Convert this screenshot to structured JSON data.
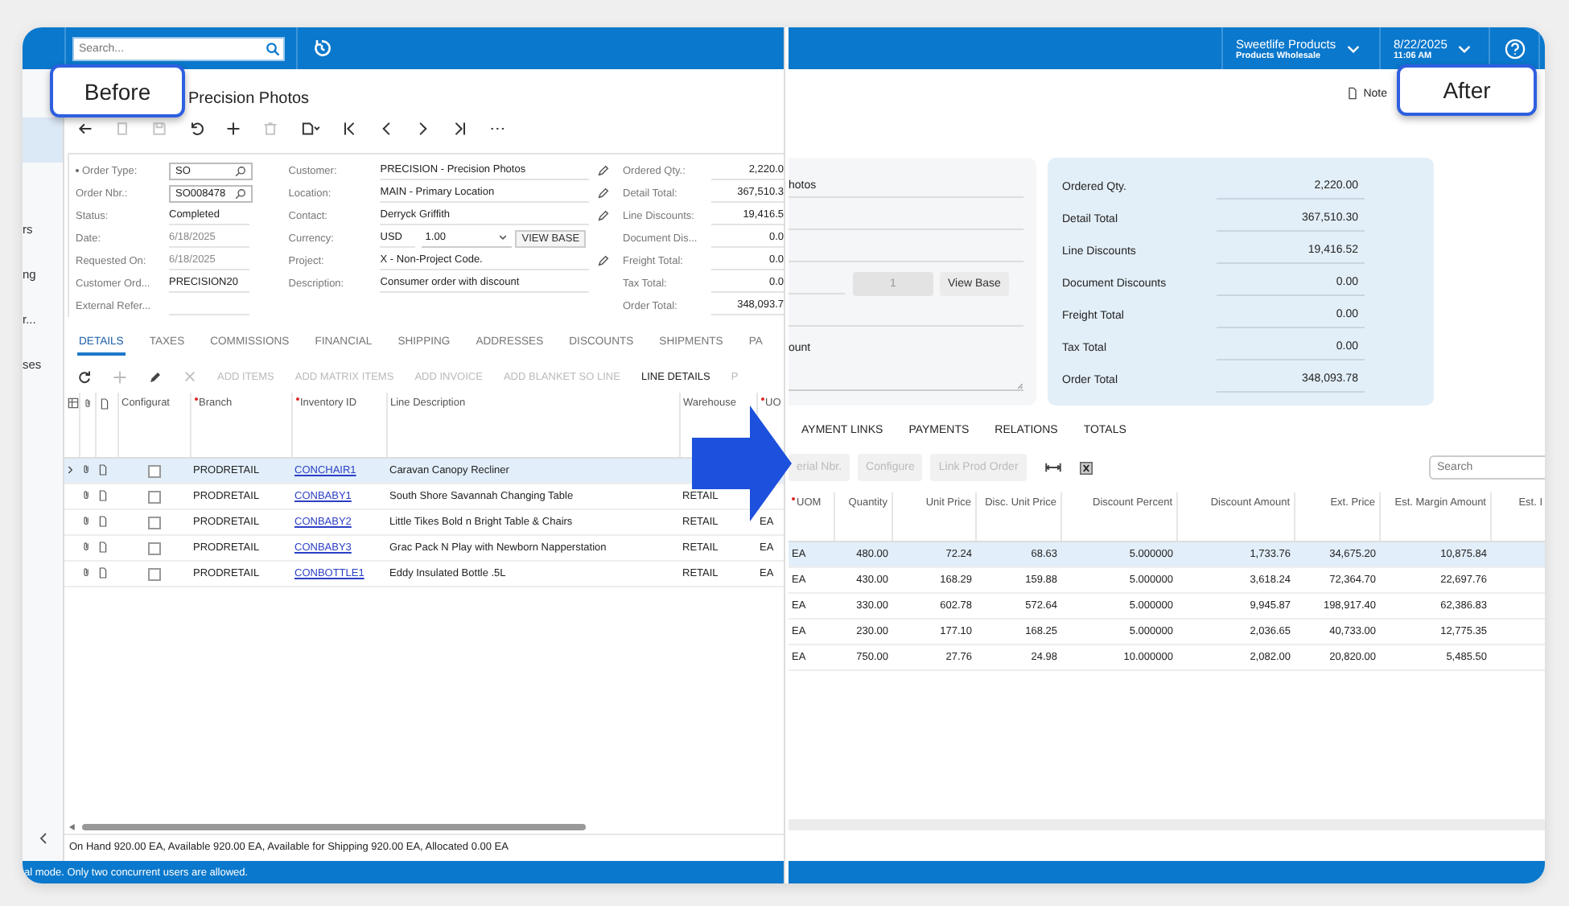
{
  "before": {
    "badge": "Before",
    "search": {
      "placeholder": "Search..."
    },
    "sidebar": {
      "items": [
        {
          "selected": true
        },
        {
          "label": "rs",
          "selected": false
        },
        {
          "label": "ng",
          "selected": false
        },
        {
          "label": "r...",
          "selected": false
        },
        {
          "label": "ses",
          "selected": false
        }
      ]
    },
    "title": "Precision Photos",
    "form": {
      "column_1": [
        {
          "label": "Order Type:",
          "required": true,
          "kind": "lookup",
          "value": "SO",
          "disabled": false
        },
        {
          "label": "Order Nbr.:",
          "required": false,
          "kind": "lookup",
          "value": "SO008478",
          "disabled": false
        },
        {
          "label": "Status:",
          "required": false,
          "kind": "text",
          "value": "Completed",
          "disabled": false
        },
        {
          "label": "Date:",
          "required": false,
          "kind": "text",
          "value": "6/18/2025",
          "disabled": true
        },
        {
          "label": "Requested On:",
          "required": false,
          "kind": "text",
          "value": "6/18/2025",
          "disabled": true
        },
        {
          "label": "Customer Ord...",
          "required": false,
          "kind": "text",
          "value": "PRECISION20",
          "disabled": false
        },
        {
          "label": "External Refer...",
          "required": false,
          "kind": "text",
          "disabled": false
        }
      ],
      "column_2": [
        {
          "label": "Customer:",
          "kind": "editable",
          "value": "PRECISION - Precision Photos"
        },
        {
          "label": "Location:",
          "kind": "editable",
          "value": "MAIN - Primary Location"
        },
        {
          "label": "Contact:",
          "kind": "editable",
          "value": "Derryck Griffith"
        },
        {
          "label": "Currency:",
          "kind": "currency",
          "value": "USD",
          "rate": "1.00",
          "button": "VIEW BASE"
        },
        {
          "label": "Project:",
          "kind": "editable",
          "value": "X - Non-Project Code."
        },
        {
          "label": "Description:",
          "kind": "text",
          "value": "Consumer order with discount"
        }
      ],
      "column_3": [
        {
          "label": "Ordered Qty.:",
          "value": "2,220.0"
        },
        {
          "label": "Detail Total:",
          "value": "367,510.3"
        },
        {
          "label": "Line Discounts:",
          "value": "19,416.5"
        },
        {
          "label": "Document Dis...",
          "value": "0.0"
        },
        {
          "label": "Freight Total:",
          "value": "0.0"
        },
        {
          "label": "Tax Total:",
          "value": "0.0"
        },
        {
          "label": "Order Total:",
          "value": "348,093.7"
        }
      ]
    },
    "tabs": [
      {
        "label": "DETAILS",
        "selected": true
      },
      {
        "label": "TAXES",
        "selected": false
      },
      {
        "label": "COMMISSIONS",
        "selected": false
      },
      {
        "label": "FINANCIAL",
        "selected": false
      },
      {
        "label": "SHIPPING",
        "selected": false
      },
      {
        "label": "ADDRESSES",
        "selected": false
      },
      {
        "label": "DISCOUNTS",
        "selected": false
      },
      {
        "label": "SHIPMENTS",
        "selected": false
      },
      {
        "label": "PA",
        "selected": false
      }
    ],
    "grid_toolbar": {
      "buttons": [
        {
          "label": "ADD ITEMS",
          "disabled": true
        },
        {
          "label": "ADD MATRIX ITEMS",
          "disabled": true
        },
        {
          "label": "ADD INVOICE",
          "disabled": true
        },
        {
          "label": "ADD BLANKET SO LINE",
          "disabled": true
        },
        {
          "label": "LINE DETAILS",
          "disabled": false
        },
        {
          "label": "P",
          "disabled": true
        }
      ]
    },
    "table": {
      "columns": [
        {
          "label": "Configurat",
          "required": false
        },
        {
          "label": "Branch",
          "required": true
        },
        {
          "label": "Inventory ID",
          "required": true
        },
        {
          "label": "Line Description",
          "required": false
        },
        {
          "label": "Warehouse",
          "required": false
        },
        {
          "label": "UO",
          "required": true
        }
      ],
      "rows": [
        {
          "selected": true,
          "configurable": false,
          "branch": "PRODRETAIL",
          "inventory_id": "CONCHAIR1",
          "description": "Caravan Canopy Recliner"
        },
        {
          "selected": false,
          "configurable": false,
          "branch": "PRODRETAIL",
          "inventory_id": "CONBABY1",
          "description": "South Shore Savannah Changing Table",
          "warehouse": "RETAIL"
        },
        {
          "selected": false,
          "configurable": false,
          "branch": "PRODRETAIL",
          "inventory_id": "CONBABY2",
          "description": "Little Tikes Bold n Bright Table & Chairs",
          "warehouse": "RETAIL",
          "uom": "EA"
        },
        {
          "selected": false,
          "configurable": false,
          "branch": "PRODRETAIL",
          "inventory_id": "CONBABY3",
          "description": "Grac Pack N Play with Newborn Napperstation",
          "warehouse": "RETAIL",
          "uom": "EA"
        },
        {
          "selected": false,
          "configurable": false,
          "branch": "PRODRETAIL",
          "inventory_id": "CONBOTTLE1",
          "description": "Eddy Insulated Bottle .5L",
          "warehouse": "RETAIL",
          "uom": "EA"
        }
      ]
    },
    "footer": "On Hand 920.00 EA, Available 920.00 EA, Available for Shipping 920.00 EA, Allocated 0.00 EA",
    "status_bar": "al mode. Only two concurrent users are allowed."
  },
  "after": {
    "badge": "After",
    "company": {
      "name": "Sweetlife Products",
      "branch": "Products Wholesale"
    },
    "business_date": {
      "date": "8/22/2025",
      "time": "11:06 AM"
    },
    "note": "Note",
    "form_card": {
      "rows": [
        {
          "kind": "text",
          "value": "hotos"
        },
        {
          "kind": "text"
        },
        {
          "kind": "text"
        },
        {
          "kind": "rate",
          "value": "1",
          "button": "View Base"
        },
        {
          "kind": "text"
        },
        {
          "kind": "label",
          "value": "ount"
        },
        {
          "kind": "textarea"
        }
      ]
    },
    "summary": [
      {
        "label": "Ordered Qty.",
        "value": "2,220.00"
      },
      {
        "label": "Detail Total",
        "value": "367,510.30"
      },
      {
        "label": "Line Discounts",
        "value": "19,416.52"
      },
      {
        "label": "Document Discounts",
        "value": "0.00"
      },
      {
        "label": "Freight Total",
        "value": "0.00"
      },
      {
        "label": "Tax Total",
        "value": "0.00"
      },
      {
        "label": "Order Total",
        "value": "348,093.78"
      }
    ],
    "tabs": [
      {
        "label": "AYMENT LINKS",
        "selected": false
      },
      {
        "label": "PAYMENTS",
        "selected": false
      },
      {
        "label": "RELATIONS",
        "selected": false
      },
      {
        "label": "TOTALS",
        "selected": false
      }
    ],
    "toolbar": {
      "buttons": [
        {
          "label": "erial Nbr.",
          "disabled": true
        },
        {
          "label": "Configure",
          "disabled": true
        },
        {
          "label": "Link Prod Order",
          "disabled": true
        }
      ],
      "search": {
        "placeholder": "Search"
      }
    },
    "table": {
      "columns": [
        {
          "label": "UOM",
          "required": true
        },
        {
          "label": "Quantity",
          "required": false
        },
        {
          "label": "Unit Price",
          "required": false
        },
        {
          "label": "Disc. Unit Price",
          "required": false
        },
        {
          "label": "Discount Percent",
          "required": false
        },
        {
          "label": "Discount Amount",
          "required": false
        },
        {
          "label": "Ext. Price",
          "required": false
        },
        {
          "label": "Est. Margin Amount",
          "required": false
        },
        {
          "label": "Est. I",
          "required": false
        }
      ],
      "rows": [
        {
          "selected": true,
          "cells": [
            "EA",
            "480.00",
            "72.24",
            "68.63",
            "5.000000",
            "1,733.76",
            "34,675.20",
            "10,875.84"
          ]
        },
        {
          "selected": false,
          "cells": [
            "EA",
            "430.00",
            "168.29",
            "159.88",
            "5.000000",
            "3,618.24",
            "72,364.70",
            "22,697.76"
          ]
        },
        {
          "selected": false,
          "cells": [
            "EA",
            "330.00",
            "602.78",
            "572.64",
            "5.000000",
            "9,945.87",
            "198,917.40",
            "62,386.83"
          ]
        },
        {
          "selected": false,
          "cells": [
            "EA",
            "230.00",
            "177.10",
            "168.25",
            "5.000000",
            "2,036.65",
            "40,733.00",
            "12,775.35"
          ]
        },
        {
          "selected": false,
          "cells": [
            "EA",
            "750.00",
            "27.76",
            "24.98",
            "10.000000",
            "2,082.00",
            "20,820.00",
            "5,485.50"
          ]
        }
      ]
    }
  }
}
